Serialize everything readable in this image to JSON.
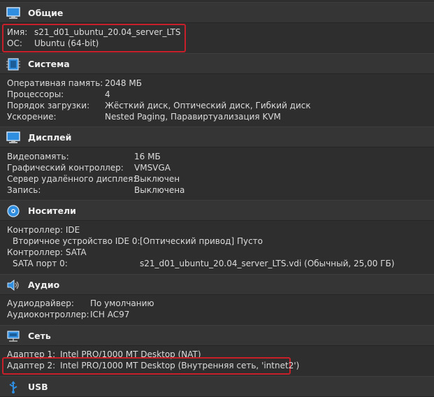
{
  "general": {
    "title": "Общие",
    "rows": [
      {
        "label": "Имя:",
        "value": "s21_d01_ubuntu_20.04_server_LTS"
      },
      {
        "label": "ОС:",
        "value": "Ubuntu (64-bit)"
      }
    ]
  },
  "system": {
    "title": "Система",
    "rows": [
      {
        "label": "Оперативная память:",
        "value": "2048 МБ"
      },
      {
        "label": "Процессоры:",
        "value": "4"
      },
      {
        "label": "Порядок загрузки:",
        "value": "Жёсткий диск, Оптический диск, Гибкий диск"
      },
      {
        "label": "Ускорение:",
        "value": "Nested Paging, Паравиртуализация KVM"
      }
    ]
  },
  "display": {
    "title": "Дисплей",
    "rows": [
      {
        "label": "Видеопамять:",
        "value": "16 МБ"
      },
      {
        "label": "Графический контроллер:",
        "value": "VMSVGA"
      },
      {
        "label": "Сервер удалённого дисплея:",
        "value": "Выключен"
      },
      {
        "label": "Запись:",
        "value": "Выключена"
      }
    ]
  },
  "storage": {
    "title": "Носители",
    "rows": [
      {
        "label": "Контроллер: IDE",
        "value": ""
      },
      {
        "label": "Вторичное устройство IDE 0:",
        "value": "[Оптический привод] Пусто"
      },
      {
        "label": "Контроллер: SATA",
        "value": ""
      },
      {
        "label": "SATA порт 0:",
        "value": "s21_d01_ubuntu_20.04_server_LTS.vdi (Обычный, 25,00 ГБ)"
      }
    ]
  },
  "audio": {
    "title": "Аудио",
    "rows": [
      {
        "label": "Аудиодрайвер:",
        "value": "По умолчанию"
      },
      {
        "label": "Аудиоконтроллер:",
        "value": "ICH AC97"
      }
    ]
  },
  "network": {
    "title": "Сеть",
    "rows": [
      {
        "label": "Адаптер 1:",
        "value": "Intel PRO/1000 MT Desktop (NAT)"
      },
      {
        "label": "Адаптер 2:",
        "value": "Intel PRO/1000 MT Desktop (Внутренняя сеть, 'intnet2')"
      }
    ]
  },
  "usb": {
    "title": "USB"
  },
  "colors": {
    "background": "#2e2e2e",
    "header": "#353535",
    "highlight": "#c8202a",
    "icon_blue": "#2f8ee0"
  }
}
